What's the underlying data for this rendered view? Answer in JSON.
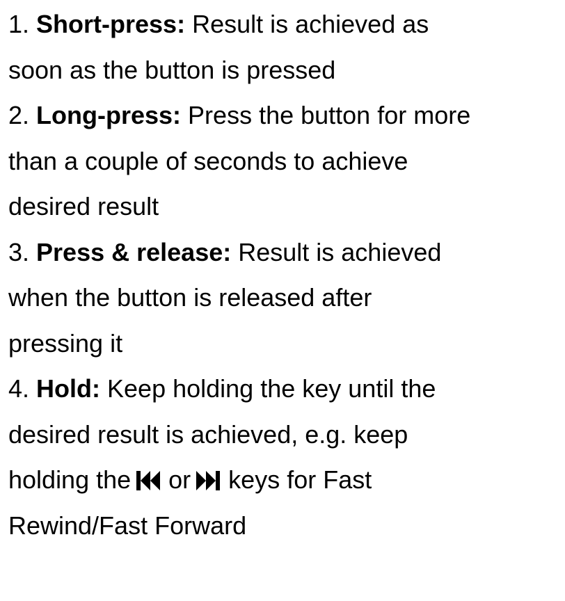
{
  "items": [
    {
      "number": "1.",
      "term": "Short-press:",
      "lines": [
        "Result is achieved as",
        "soon as the button is pressed"
      ]
    },
    {
      "number": "2.",
      "term": "Long-press:",
      "lines": [
        "Press the button for more",
        "than a couple of seconds to achieve",
        "desired result"
      ]
    },
    {
      "number": "3.",
      "term": "Press & release:",
      "lines": [
        "Result is achieved",
        "when the button is released after",
        "pressing it"
      ]
    },
    {
      "number": "4.",
      "term": "Hold:",
      "lines": [
        "Keep holding the key until the",
        "desired result is achieved, e.g. keep"
      ],
      "icon_line": {
        "before": "holding the",
        "icon1": "skip-back-icon",
        "middle": "or",
        "icon2": "skip-forward-icon",
        "after": "keys for Fast"
      },
      "last_line": "Rewind/Fast Forward"
    }
  ]
}
